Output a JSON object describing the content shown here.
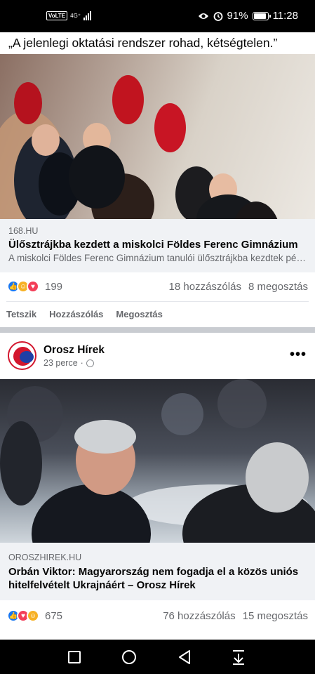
{
  "status_bar": {
    "volte": "VoLTE",
    "network": "4G⁺",
    "battery_percent": "91%",
    "battery_level": 0.91,
    "time": "11:28",
    "icons": [
      "eye-icon",
      "alarm-icon",
      "battery-icon",
      "signal-icon"
    ]
  },
  "post1": {
    "text": "„A jelenlegi oktatási rendszer rohad, kétségtelen.”",
    "link": {
      "source": "168.HU",
      "title": "Ülősztrájkba kezdett a miskolci Földes Ferenc Gimnázium",
      "description": "A miskolci Földes Ferenc Gimnázium tanulói ülősztrájkba kezdtek pénte…"
    },
    "reaction_count": "199",
    "comments": "18 hozzászólás",
    "shares": "8 megosztás",
    "actions": {
      "like": "Tetszik",
      "comment": "Hozzászólás",
      "share": "Megosztás"
    }
  },
  "post2": {
    "page_name": "Orosz Hírek",
    "time": "23 perce",
    "separator_dot": "·",
    "more": "•••",
    "link": {
      "source": "OROSZHIREK.HU",
      "title": "Orbán Viktor: Magyarország nem fogadja el a közös uniós hitelfelvételt Ukrajnáért – Orosz Hírek"
    },
    "reaction_count": "675",
    "comments": "76 hozzászólás",
    "shares": "15 megosztás"
  },
  "colors": {
    "facebook_blue": "#1877f2",
    "love_red": "#f33e58",
    "care_yellow": "#f7b125",
    "secondary_text": "#65676b",
    "link_box_bg": "#f0f2f5"
  }
}
